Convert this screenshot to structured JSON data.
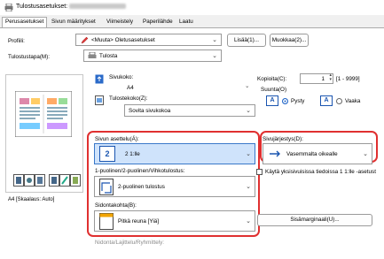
{
  "window": {
    "title": "Tulostusasetukset:"
  },
  "tabs": [
    {
      "label": "Perusasetukset"
    },
    {
      "label": "Sivun määritykset"
    },
    {
      "label": "Viimeistely"
    },
    {
      "label": "Paperilähde"
    },
    {
      "label": "Laatu"
    }
  ],
  "profile": {
    "label": "Profiili:",
    "value": "<Muuta> Oletusasetukset",
    "add_button": "Lisää(1)...",
    "edit_button": "Muokkaa(2)..."
  },
  "output_method": {
    "label": "Tulostustapa(M):",
    "value": "Tulosta"
  },
  "page_size": {
    "label": "Sivukoko:",
    "value": "A4"
  },
  "output_size": {
    "label": "Tulostekoko(Z):",
    "value": "Sovita sivukokoa"
  },
  "copies": {
    "label": "Kopioita(C):",
    "value": "1",
    "range": "[1 - 9999]"
  },
  "orientation": {
    "label": "Suunta(O)",
    "portrait": "Pysty",
    "landscape": "Vaaka",
    "selected": "portrait"
  },
  "page_layout": {
    "label": "Sivun asettelu(Á):",
    "number": "2",
    "value": "2 1:lle"
  },
  "page_order": {
    "label": "Sivujärjestys(D):",
    "value": "Vasemmalta oikealle"
  },
  "duplex": {
    "label": "1-puolinen/2-puolinen/Vihkotulostus:",
    "value": "2-puolinen tulostus"
  },
  "binding": {
    "label": "Sidontakohta(B):",
    "value": "Pitkä reuna [Yiä]"
  },
  "single_sided_checkbox": {
    "label": "Käytä yksisivuisissa tiedoissa 1 1:lle -asetust",
    "checked": false
  },
  "margin_button": "Sisämarginaali(U)...",
  "preview_caption": "A4 [Skaalaus: Auto]",
  "footer_label": "Nidonta/Lajittelu/Ryhmittely:",
  "colors": {
    "highlight_red": "#e03030",
    "selection_blue": "#cfe3fb",
    "accent_blue": "#1f64c7"
  }
}
